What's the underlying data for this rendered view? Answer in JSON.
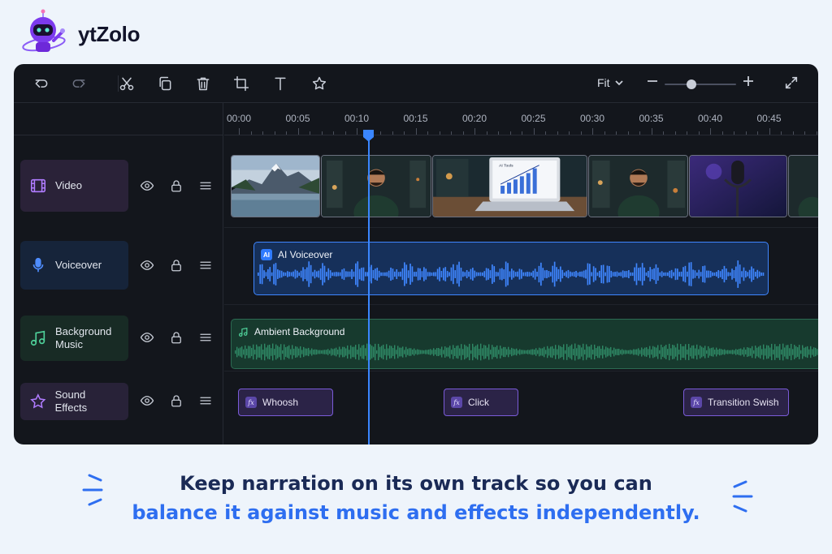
{
  "brand": {
    "name": "ytZolo",
    "logo_icon": "robot-mascot-icon"
  },
  "toolbar": {
    "buttons": [
      {
        "name": "undo-button",
        "icon": "undo-icon"
      },
      {
        "name": "redo-button",
        "icon": "redo-icon"
      },
      {
        "name": "cut-button",
        "icon": "scissors-icon"
      },
      {
        "name": "copy-button",
        "icon": "copy-icon"
      },
      {
        "name": "delete-button",
        "icon": "trash-icon"
      },
      {
        "name": "crop-button",
        "icon": "crop-icon"
      },
      {
        "name": "text-button",
        "icon": "text-icon"
      },
      {
        "name": "favorite-button",
        "icon": "star-icon"
      }
    ],
    "zoom_label": "Fit",
    "zoom_level": 0.38
  },
  "timeline": {
    "ruler": [
      "00:00",
      "00:05",
      "00:10",
      "00:15",
      "00:20",
      "00:25",
      "00:30",
      "00:35",
      "00:40",
      "00:45"
    ],
    "playhead": "00:11"
  },
  "tracks": [
    {
      "label": "Video",
      "icon": "film-icon"
    },
    {
      "label": "Voiceover",
      "icon": "microphone-icon"
    },
    {
      "label": "Background\nMusic",
      "icon": "music-note-icon"
    },
    {
      "label": "Sound Effects",
      "icon": "star-icon"
    }
  ],
  "clips": {
    "voiceover": {
      "badge": "AI",
      "label": "AI Voiceover"
    },
    "music": {
      "label": "Ambient Background"
    },
    "laptop_screen_text": "AI Tools",
    "sfx": [
      {
        "badge": "fx",
        "label": "Whoosh"
      },
      {
        "badge": "fx",
        "label": "Click"
      },
      {
        "badge": "fx",
        "label": "Transition Swish"
      }
    ]
  },
  "colors": {
    "editor_bg": "#13161c",
    "playhead": "#3a86ff",
    "voiceover": "#3f86ff",
    "music": "#2f8a66",
    "sfx": "#7a5bd8",
    "caption_dark": "#1a2a56",
    "caption_accent": "#2e6ef0"
  },
  "caption": {
    "line1": "Keep narration on its own track so you can",
    "line2": "balance it against music and effects independently."
  }
}
